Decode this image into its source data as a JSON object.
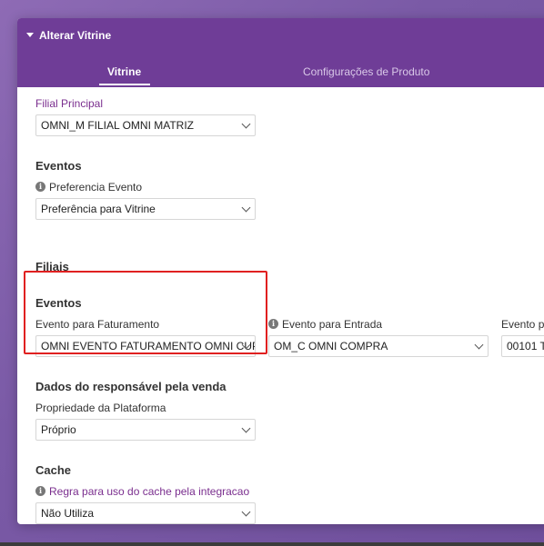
{
  "modal": {
    "title": "Alterar Vitrine",
    "tabs": [
      {
        "label": "Vitrine",
        "active": true
      },
      {
        "label": "Configurações de Produto",
        "active": false
      }
    ]
  },
  "form": {
    "filial_principal": {
      "label": "Filial Principal",
      "value": "OMNI_M FILIAL OMNI MATRIZ"
    },
    "eventos_section": "Eventos",
    "preferencia_evento": {
      "label": "Preferencia Evento",
      "value": "Preferência para Vitrine"
    },
    "filiais_section": "Filiais",
    "eventos2_section": "Eventos",
    "evento_faturamento": {
      "label": "Evento para Faturamento",
      "value": "OMNI EVENTO FATURAMENTO OMNI CUPO"
    },
    "evento_entrada": {
      "label": "Evento para Entrada",
      "value": "OM_C OMNI COMPRA"
    },
    "evento_third": {
      "label": "Evento p",
      "value": "00101 T"
    },
    "dados_section": "Dados do responsável pela venda",
    "propriedade_plataforma": {
      "label": "Propriedade da Plataforma",
      "value": "Próprio"
    },
    "cache_section": "Cache",
    "regra_cache": {
      "label": "Regra para uso do cache pela integracao",
      "value": "Não Utiliza"
    }
  },
  "colors": {
    "header": "#6f3d97",
    "highlight": "#e02020",
    "accent_label": "#7a2e8e"
  }
}
